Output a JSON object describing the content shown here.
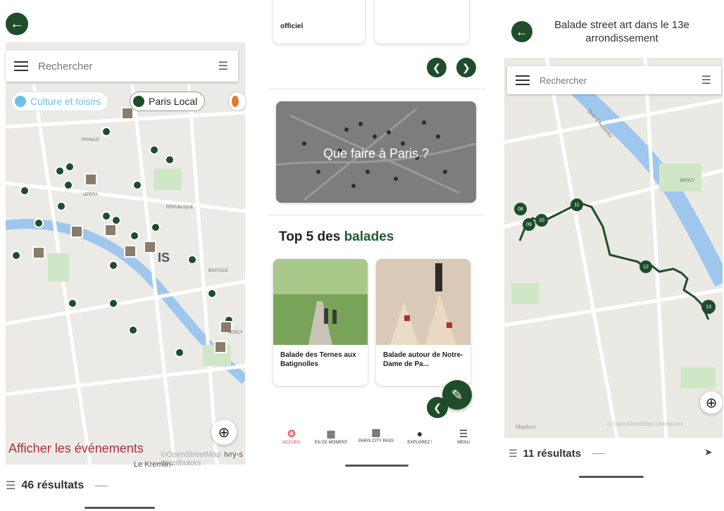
{
  "screen1": {
    "search_placeholder": "Rechercher",
    "chips": [
      {
        "label": "Culture et loisirs",
        "color": "#6ec0e8"
      },
      {
        "label": "Paris Local",
        "color": "#1f4d2b"
      }
    ],
    "map_label_is": "IS",
    "map_labels": [
      "PIGALLE",
      "OPÉRA",
      "RÉPUBLIQUE",
      "BASTILLE",
      "BERCY"
    ],
    "events_link": "Afficher les événements",
    "map_town": "Le Kremlin-",
    "map_attrib": "©OpenStreetMap contributors",
    "map_town2": "Ivry-s",
    "result_count": "46 résultats"
  },
  "screen2": {
    "top_card_text": "officiel",
    "banner_text": "Que faire à Paris ?",
    "section_title_plain": "Top 5 des ",
    "section_title_accent": "balades",
    "walk_cards": [
      {
        "title": "Balade des Ternes aux Batignolles"
      },
      {
        "title": "Balade autour de Notre-Dame de Pa..."
      }
    ],
    "nav": [
      {
        "label": "ACCUEIL",
        "icon": "compass-icon"
      },
      {
        "label": "EN CE MOMENT",
        "icon": "calendar-icon"
      },
      {
        "label": "PARIS CITY PASS",
        "icon": "qr-icon"
      },
      {
        "label": "EXPLOREZ !",
        "icon": "pin-icon"
      },
      {
        "label": "MENU",
        "icon": "menu-icon"
      }
    ],
    "accent_color": "#1f5c33"
  },
  "screen3": {
    "title": "Balade street art dans le 13e arrondissement",
    "search_placeholder": "Rechercher",
    "route_points": [
      "08",
      "09",
      "10",
      "11",
      "12",
      "13"
    ],
    "map_area_label": "BERCY",
    "street_label": "Quai d'Austerlitz",
    "map_attrib_left": "Mapbox",
    "map_attrib_right": "© OpenStreetMap contributors",
    "result_count": "11 résultats"
  }
}
